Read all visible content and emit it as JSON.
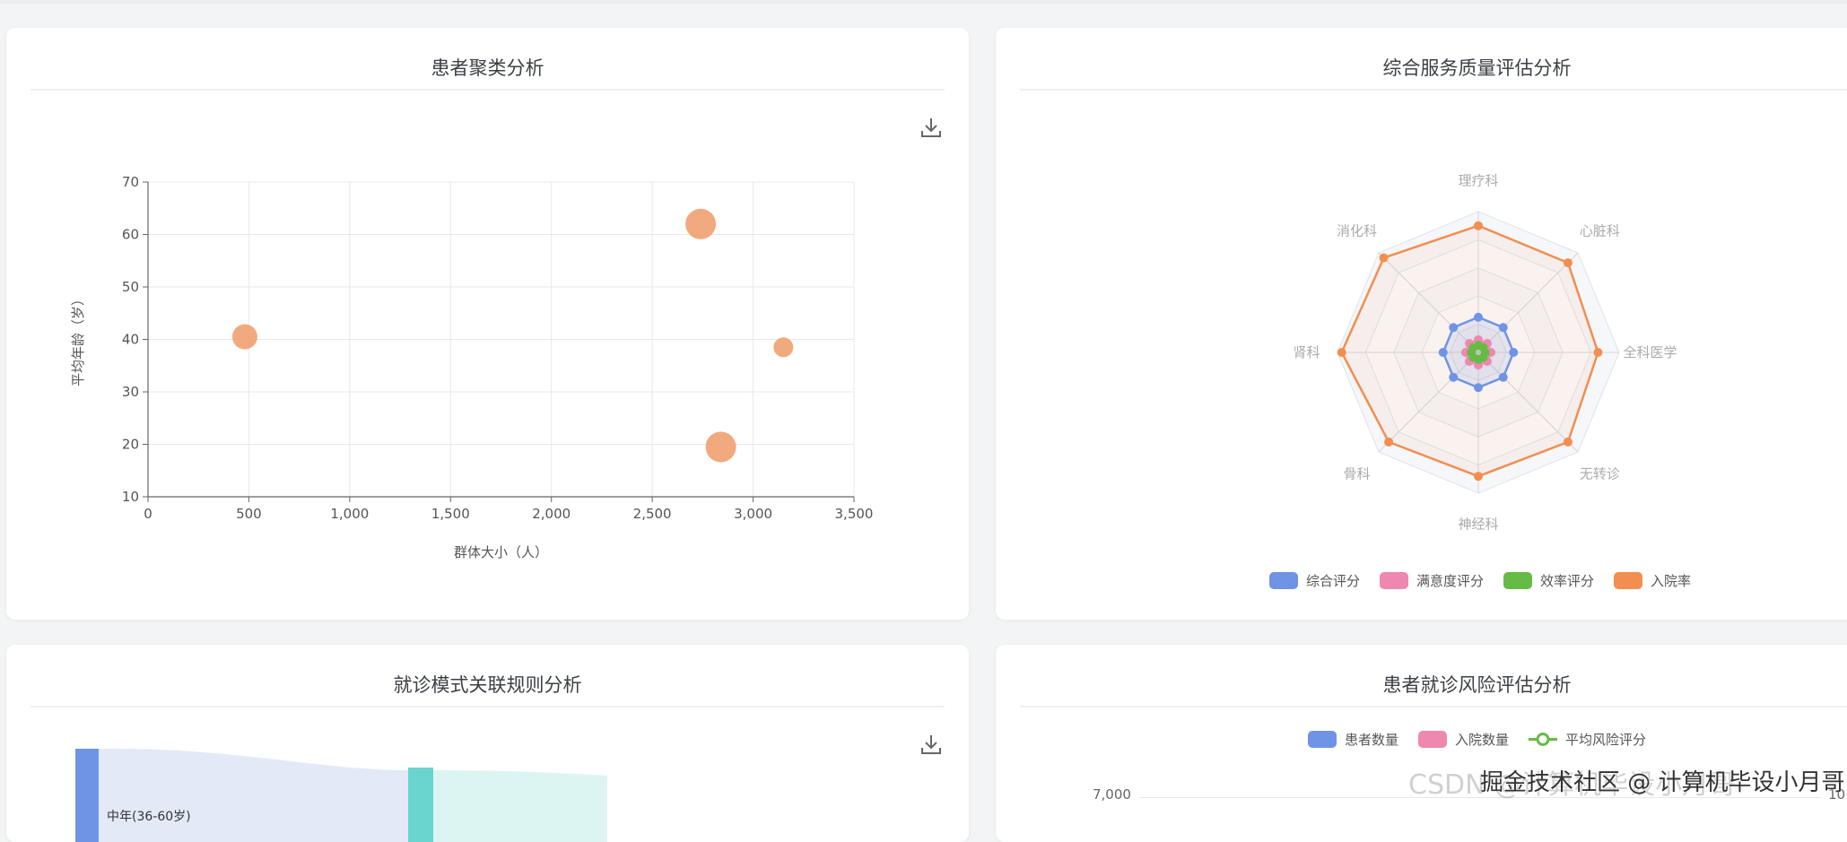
{
  "colors": {
    "bubble": "#f0a070",
    "blue": "#6f94e6",
    "pink": "#ee88b0",
    "green": "#66bb44",
    "orange": "#f28e4f",
    "teal": "#6ad4cf"
  },
  "cluster": {
    "title": "患者聚类分析",
    "download_icon": "download-icon",
    "chart_data": {
      "type": "scatter",
      "title": "患者聚类分析",
      "xlabel": "群体大小（人）",
      "ylabel": "平均年龄（岁）",
      "xlim": [
        0,
        3500
      ],
      "ylim": [
        10,
        70
      ],
      "x_ticks": [
        "0",
        "500",
        "1,000",
        "1,500",
        "2,000",
        "2,500",
        "3,000",
        "3,500"
      ],
      "y_ticks": [
        "10",
        "20",
        "30",
        "40",
        "50",
        "60",
        "70"
      ],
      "grid": true,
      "points": [
        {
          "x": 480,
          "y": 40.5,
          "size": 2
        },
        {
          "x": 2740,
          "y": 62,
          "size": 3
        },
        {
          "x": 2840,
          "y": 19.5,
          "size": 3
        },
        {
          "x": 3150,
          "y": 38.5,
          "size": 1
        }
      ]
    }
  },
  "service": {
    "title": "综合服务质量评估分析",
    "chart_data": {
      "type": "radar",
      "title": "综合服务质量评估分析",
      "indicators": [
        "理疗科",
        "心脏科",
        "全科医学",
        "无转诊",
        "神经科",
        "骨科",
        "肾科",
        "消化科"
      ],
      "series": [
        {
          "name": "综合评分",
          "values": [
            0.25,
            0.25,
            0.25,
            0.25,
            0.25,
            0.25,
            0.25,
            0.25
          ]
        },
        {
          "name": "满意度评分",
          "values": [
            0.09,
            0.09,
            0.09,
            0.09,
            0.09,
            0.09,
            0.09,
            0.09
          ]
        },
        {
          "name": "效率评分",
          "values": [
            0.05,
            0.05,
            0.05,
            0.05,
            0.05,
            0.05,
            0.05,
            0.05
          ]
        },
        {
          "name": "入院率",
          "values": [
            0.9,
            0.9,
            0.85,
            0.9,
            0.88,
            0.9,
            0.97,
            0.95
          ]
        }
      ],
      "legend_position": "bottom"
    }
  },
  "pattern": {
    "title": "就诊模式关联规则分析",
    "download_icon": "download-icon",
    "node_label": "中年(36-60岁)"
  },
  "risk": {
    "title": "患者就诊风险评估分析",
    "legend": [
      "患者数量",
      "入院数量",
      "平均风险评分"
    ],
    "y_tick_top": "7,000",
    "y2_tick_top": "10"
  },
  "watermark": {
    "back": "CSDN @计算机毕设小月哥",
    "front": "掘金技术社区 @ 计算机毕设小月哥"
  }
}
